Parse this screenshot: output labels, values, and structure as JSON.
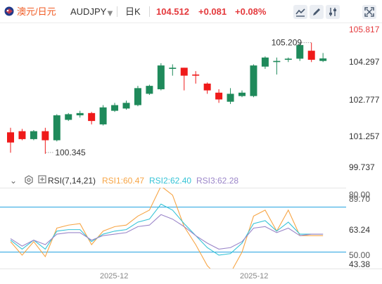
{
  "header": {
    "name_cn": "澳元/日元",
    "symbol": "AUDJPY",
    "period": "日K",
    "price": "104.512",
    "change": "+0.081",
    "change_pct": "+0.08%",
    "icons": [
      "line-chart-icon",
      "pencil-icon",
      "settings-sliders-icon",
      "fullscreen-icon"
    ]
  },
  "price_axis": {
    "labels": [
      "105.817",
      "104.297",
      "102.777",
      "101.257",
      "99.737"
    ],
    "top_label_color": "#e4393c"
  },
  "annotations": {
    "high": "105.209",
    "low": "100.345"
  },
  "rsi": {
    "title": "RSI(7,14,21)",
    "rsi1": "RSI1:60.47",
    "rsi2": "RSI2:62.40",
    "rsi3": "RSI3:62.28",
    "axis_labels": {
      "l1": "80.00",
      "l2": "89.70",
      "l3": "63.24",
      "l4": "50.00",
      "l5": "43.38"
    }
  },
  "x_axis": {
    "labels": [
      "2025-12",
      "2025-12"
    ]
  },
  "colors": {
    "up": "#1f8a5b",
    "down": "#ef1a1a",
    "rsi1": "#f7a545",
    "rsi2": "#35c3d6",
    "rsi3": "#9b86c9",
    "level_line": "#1fa1e0"
  },
  "chart_data": {
    "type": "candlestick",
    "ylim": [
      99.737,
      105.817
    ],
    "candles": [
      {
        "o": 101.25,
        "h": 101.45,
        "l": 100.35,
        "c": 100.8
      },
      {
        "o": 101.3,
        "h": 101.4,
        "l": 100.9,
        "c": 100.95
      },
      {
        "o": 100.95,
        "h": 101.35,
        "l": 100.9,
        "c": 101.3
      },
      {
        "o": 101.3,
        "h": 101.45,
        "l": 100.3,
        "c": 100.9
      },
      {
        "o": 100.9,
        "h": 102.05,
        "l": 100.85,
        "c": 102.0
      },
      {
        "o": 101.8,
        "h": 102.1,
        "l": 101.75,
        "c": 102.05
      },
      {
        "o": 102.0,
        "h": 102.2,
        "l": 101.9,
        "c": 102.1
      },
      {
        "o": 102.1,
        "h": 102.15,
        "l": 101.6,
        "c": 101.75
      },
      {
        "o": 101.6,
        "h": 102.45,
        "l": 101.55,
        "c": 102.35
      },
      {
        "o": 102.2,
        "h": 102.55,
        "l": 102.15,
        "c": 102.45
      },
      {
        "o": 102.3,
        "h": 102.65,
        "l": 102.25,
        "c": 102.55
      },
      {
        "o": 102.45,
        "h": 103.3,
        "l": 102.4,
        "c": 103.2
      },
      {
        "o": 102.95,
        "h": 103.35,
        "l": 102.9,
        "c": 103.3
      },
      {
        "o": 103.15,
        "h": 104.3,
        "l": 103.1,
        "c": 104.2
      },
      {
        "o": 104.05,
        "h": 104.25,
        "l": 103.75,
        "c": 104.1
      },
      {
        "o": 104.1,
        "h": 104.1,
        "l": 103.1,
        "c": 103.75
      },
      {
        "o": 103.8,
        "h": 103.95,
        "l": 103.4,
        "c": 103.75
      },
      {
        "o": 103.4,
        "h": 103.45,
        "l": 102.95,
        "c": 103.1
      },
      {
        "o": 103.0,
        "h": 103.15,
        "l": 102.55,
        "c": 102.7
      },
      {
        "o": 102.6,
        "h": 103.2,
        "l": 102.5,
        "c": 102.95
      },
      {
        "o": 102.85,
        "h": 103.1,
        "l": 102.8,
        "c": 103.0
      },
      {
        "o": 102.85,
        "h": 104.25,
        "l": 102.8,
        "c": 104.2
      },
      {
        "o": 104.15,
        "h": 104.6,
        "l": 104.05,
        "c": 104.55
      },
      {
        "o": 104.35,
        "h": 104.55,
        "l": 103.8,
        "c": 104.4
      },
      {
        "o": 104.45,
        "h": 104.55,
        "l": 104.35,
        "c": 104.5
      },
      {
        "o": 104.5,
        "h": 105.2,
        "l": 104.4,
        "c": 105.1
      },
      {
        "o": 104.85,
        "h": 105.21,
        "l": 104.35,
        "c": 104.45
      },
      {
        "o": 104.4,
        "h": 104.75,
        "l": 104.35,
        "c": 104.51
      }
    ],
    "rsi_ylim": [
      40,
      92
    ],
    "rsi_series": [
      {
        "name": "RSI1",
        "values": [
          57,
          48,
          57,
          47,
          66,
          68,
          69,
          55,
          64,
          67,
          68,
          74,
          78,
          94,
          88,
          67,
          55,
          41,
          33,
          36,
          50,
          74,
          78,
          64,
          78,
          61,
          61,
          61
        ]
      },
      {
        "name": "RSI2",
        "values": [
          58,
          52,
          58,
          52,
          64,
          65,
          65,
          57,
          62,
          64,
          65,
          70,
          72,
          82,
          78,
          69,
          61,
          53,
          48,
          49,
          56,
          69,
          71,
          64,
          70,
          62,
          62,
          62
        ]
      },
      {
        "name": "RSI3",
        "values": [
          59,
          54,
          58,
          55,
          62,
          63,
          63,
          58,
          61,
          62,
          63,
          67,
          68,
          75,
          72,
          67,
          61,
          56,
          52,
          53,
          57,
          66,
          67,
          63,
          66,
          61,
          62,
          62
        ]
      }
    ],
    "levels": [
      80,
      50
    ]
  }
}
